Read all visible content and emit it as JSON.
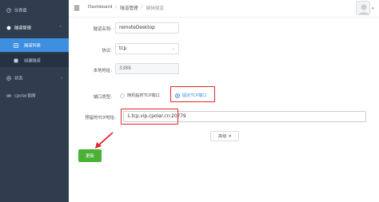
{
  "sidebar": {
    "items": [
      {
        "label": "仪表盘",
        "icon": "dashboard-icon"
      },
      {
        "label": "隧道管理",
        "icon": "tunnel-icon",
        "expanded": true
      },
      {
        "label": "隧道列表",
        "icon": "list-icon",
        "active": true
      },
      {
        "label": "创建隧道",
        "icon": "create-icon"
      },
      {
        "label": "状态",
        "icon": "status-icon"
      },
      {
        "label": "cpolar官网",
        "icon": "link-icon"
      }
    ]
  },
  "header": {
    "breadcrumb": [
      "Dashboard",
      "隧道管理",
      "编辑隧道"
    ],
    "separator": "/"
  },
  "form": {
    "tunnel_name": {
      "label": "隧道名称:",
      "value": "remoteDesktop"
    },
    "protocol": {
      "label": "协议:",
      "value": "tcp"
    },
    "local_address": {
      "label": "本地地址:",
      "value": "3389"
    },
    "port_type": {
      "label": "端口类型:",
      "options": [
        "随机临时TCP端口",
        "固定TCP端口"
      ],
      "selected": "固定TCP端口"
    },
    "reserved_tcp": {
      "label": "预留的TCP地址:",
      "value": "1.tcp.vip.cpolar.cn:20779"
    },
    "advanced_label": "高级",
    "save_label": "更新"
  },
  "colors": {
    "sidebar_bg": "#2f3d4f",
    "active": "#3d8fe0",
    "highlight": "#e3262a",
    "save": "#49b234"
  }
}
